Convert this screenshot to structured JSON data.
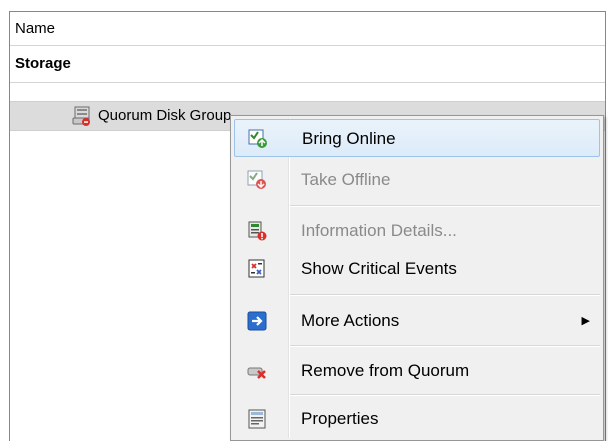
{
  "list": {
    "column_header": "Name",
    "group_label": "Storage",
    "item_label": "Quorum Disk Group"
  },
  "context_menu": {
    "items": [
      {
        "label": "Bring Online",
        "icon": "bring-online-icon",
        "enabled": true,
        "highlighted": true
      },
      {
        "label": "Take Offline",
        "icon": "take-offline-icon",
        "enabled": false
      },
      {
        "label": "Information Details...",
        "icon": "information-details-icon",
        "enabled": false
      },
      {
        "label": "Show Critical Events",
        "icon": "critical-events-icon",
        "enabled": true
      },
      {
        "label": "More Actions",
        "icon": "more-actions-icon",
        "enabled": true,
        "submenu": true
      },
      {
        "label": "Remove from Quorum",
        "icon": "remove-quorum-icon",
        "enabled": true
      },
      {
        "label": "Properties",
        "icon": "properties-icon",
        "enabled": true
      }
    ]
  }
}
